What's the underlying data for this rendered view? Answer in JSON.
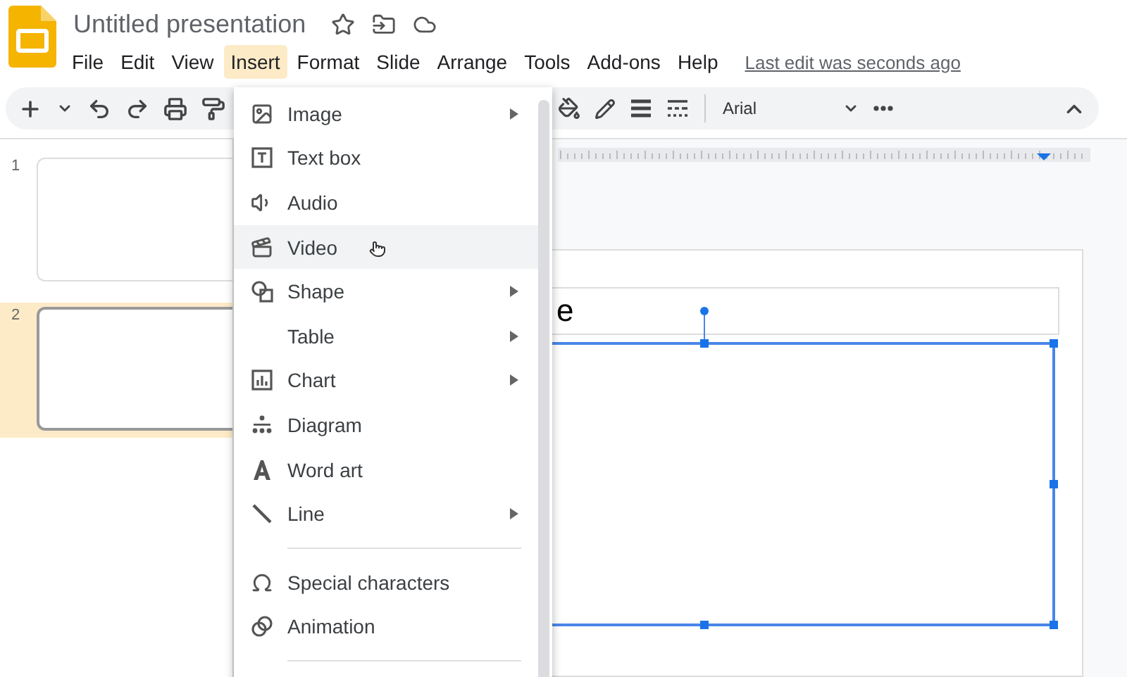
{
  "app": {
    "title": "Untitled presentation",
    "last_edit": "Last edit was seconds ago"
  },
  "menubar": [
    {
      "label": "File",
      "selected": false
    },
    {
      "label": "Edit",
      "selected": false
    },
    {
      "label": "View",
      "selected": false
    },
    {
      "label": "Insert",
      "selected": true
    },
    {
      "label": "Format",
      "selected": false
    },
    {
      "label": "Slide",
      "selected": false
    },
    {
      "label": "Arrange",
      "selected": false
    },
    {
      "label": "Tools",
      "selected": false
    },
    {
      "label": "Add-ons",
      "selected": false
    },
    {
      "label": "Help",
      "selected": false
    }
  ],
  "toolbar": {
    "font": "Arial"
  },
  "slides": [
    {
      "number": "1",
      "selected": false
    },
    {
      "number": "2",
      "selected": true
    }
  ],
  "insert_menu": {
    "groups": [
      [
        {
          "label": "Image",
          "submenu": true,
          "selected": false
        },
        {
          "label": "Text box",
          "submenu": false,
          "selected": false
        },
        {
          "label": "Audio",
          "submenu": false,
          "selected": false
        },
        {
          "label": "Video",
          "submenu": false,
          "selected": true
        },
        {
          "label": "Shape",
          "submenu": true,
          "selected": false
        },
        {
          "label": "Table",
          "submenu": true,
          "selected": false
        },
        {
          "label": "Chart",
          "submenu": true,
          "selected": false
        },
        {
          "label": "Diagram",
          "submenu": false,
          "selected": false
        },
        {
          "label": "Word art",
          "submenu": false,
          "selected": false
        },
        {
          "label": "Line",
          "submenu": true,
          "selected": false
        }
      ],
      [
        {
          "label": "Special characters",
          "submenu": false,
          "selected": false
        },
        {
          "label": "Animation",
          "submenu": false,
          "selected": false
        }
      ]
    ]
  },
  "canvas": {
    "title_text": "e"
  }
}
